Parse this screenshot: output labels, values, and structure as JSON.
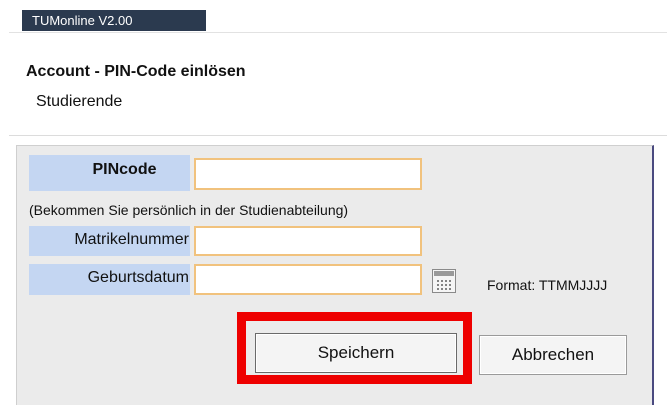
{
  "app": {
    "title": "TUMonline V2.00"
  },
  "header": {
    "title": "Account - PIN-Code einlösen",
    "subtitle": "Studierende"
  },
  "form": {
    "pincode": {
      "label": "PINcode",
      "value": ""
    },
    "hint": "(Bekommen Sie persönlich in der Studienabteilung)",
    "matrikelnummer": {
      "label": "Matrikelnummer",
      "value": ""
    },
    "geburtsdatum": {
      "label": "Geburtsdatum",
      "value": "",
      "format_hint": "Format: TTMMJJJJ"
    },
    "calendar_icon": "calendar-icon"
  },
  "actions": {
    "save_label": "Speichern",
    "cancel_label": "Abbrechen"
  },
  "colors": {
    "tab_bg": "#2b3a4f",
    "label_bg": "#c4d6f2",
    "field_border": "#f1c27d",
    "panel_bg": "#ebebeb",
    "highlight": "#ee0000"
  }
}
